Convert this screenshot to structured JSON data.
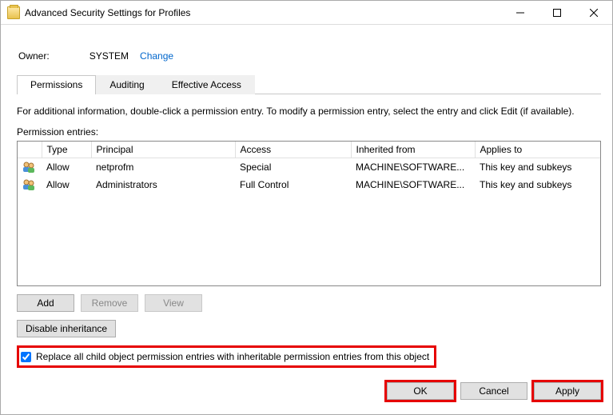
{
  "title": "Advanced Security Settings for Profiles",
  "owner": {
    "label": "Owner:",
    "value": "SYSTEM",
    "change": "Change"
  },
  "tabs": {
    "permissions": "Permissions",
    "auditing": "Auditing",
    "effective": "Effective Access"
  },
  "instruction": "For additional information, double-click a permission entry. To modify a permission entry, select the entry and click Edit (if available).",
  "entries_label": "Permission entries:",
  "columns": {
    "type": "Type",
    "principal": "Principal",
    "access": "Access",
    "inherited": "Inherited from",
    "applies": "Applies to"
  },
  "rows": [
    {
      "type": "Allow",
      "principal": "netprofm",
      "access": "Special",
      "inherited": "MACHINE\\SOFTWARE...",
      "applies": "This key and subkeys"
    },
    {
      "type": "Allow",
      "principal": "Administrators",
      "access": "Full Control",
      "inherited": "MACHINE\\SOFTWARE...",
      "applies": "This key and subkeys"
    }
  ],
  "buttons": {
    "add": "Add",
    "remove": "Remove",
    "view": "View",
    "disable": "Disable inheritance"
  },
  "checkbox": "Replace all child object permission entries with inheritable permission entries from this object",
  "footer": {
    "ok": "OK",
    "cancel": "Cancel",
    "apply": "Apply"
  }
}
